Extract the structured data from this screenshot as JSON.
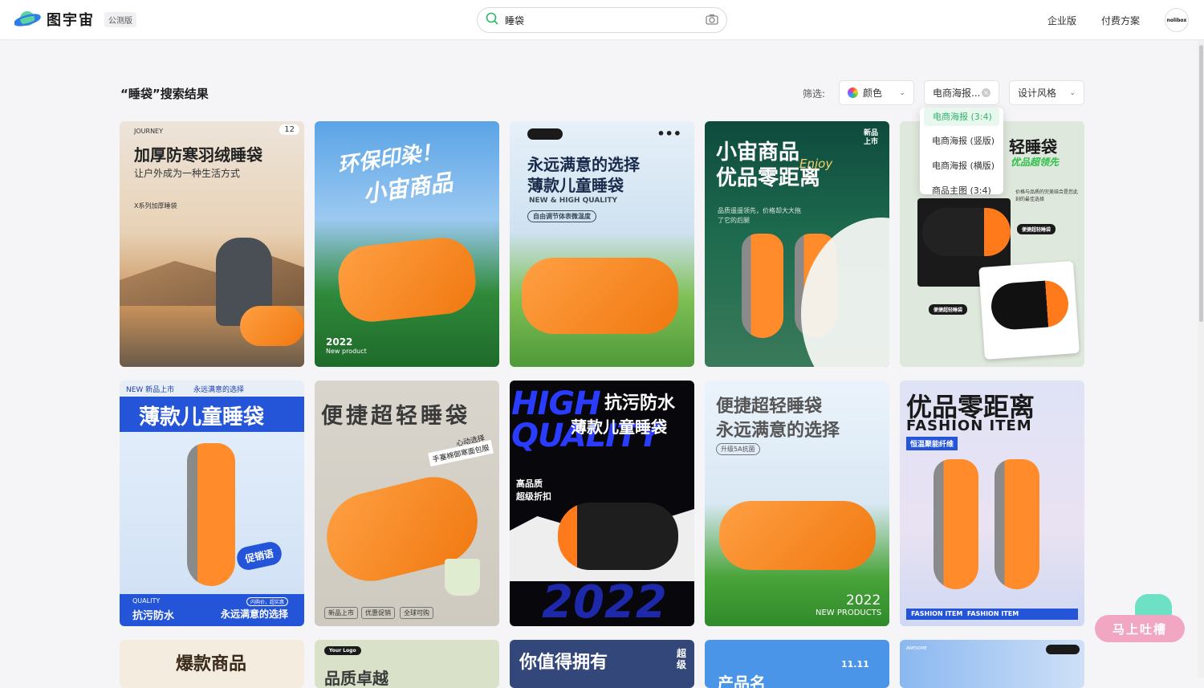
{
  "header": {
    "logo_text": "图宇宙",
    "beta_label": "公测版",
    "search_value": "睡袋",
    "enterprise_link": "企业版",
    "pricing_link": "付费方案",
    "avatar_text": "nolibox"
  },
  "results": {
    "title": "“睡袋”搜索结果",
    "filter_label": "筛选:",
    "filters": {
      "color": "颜色",
      "type": "电商海报...",
      "style": "设计风格"
    },
    "dropdown_options": [
      "电商海报 (3:4)",
      "电商海报 (竖版)",
      "电商海报 (横版)",
      "商品主图 (3:4)"
    ]
  },
  "cards": {
    "c1": {
      "tag": "JOURNEY",
      "count": "12",
      "title": "加厚防寒羽绒睡袋",
      "subtitle": "让户外成为一种生活方式",
      "note": "X系列加厚睡袋"
    },
    "c2": {
      "title1": "环保印染！",
      "title2": "小宙商品",
      "year": "2022",
      "sub": "New product"
    },
    "c3": {
      "title1": "永远满意的选择",
      "title2": "薄款儿童睡袋",
      "sub": "NEW & HIGH QUALITY",
      "pill": "自由调节体表微温度"
    },
    "c4": {
      "title1": "小宙商品",
      "title2": "优品零距离",
      "enjoy": "Enjoy",
      "badge": "新品上市",
      "desc": "品质遥遥领先，价格却大大拖了它的后腿"
    },
    "c5": {
      "title": "轻睡袋",
      "sub": "优品超领先",
      "desc": "价格与品质的完美结合是您此刻的最佳选择",
      "label1": "便捷超轻睡袋",
      "label2": "便捷超轻睡袋"
    },
    "c6": {
      "top": "NEW 新品上市",
      "top2": "永远满意的选择",
      "title": "薄款儿童睡袋",
      "promo": "促销语",
      "quality": "QUALITY",
      "foot1": "抗污防水",
      "foot2": "永远满意的选择",
      "tag": "内购价，超实惠"
    },
    "c7": {
      "title": "便捷超轻睡袋",
      "note1": "心动选择",
      "note2": "手塞棉御寒面包服",
      "t1": "新品上市",
      "t2": "优惠促销",
      "t3": "全球可购"
    },
    "c8": {
      "big1": "HIGH",
      "big2": "QUALITY",
      "title1": "抗污防水",
      "title2": "薄款儿童睡袋",
      "sub1": "高品质",
      "sub2": "超级折扣",
      "year": "2022"
    },
    "c9": {
      "title1": "便捷超轻睡袋",
      "title2": "永远满意的选择",
      "pill": "升级5A抗菌",
      "year": "2022",
      "sub": "NEW PRODUCTS"
    },
    "c10": {
      "title": "优品零距离",
      "sub": "FASHION ITEM",
      "tag": "恒温聚能纤维",
      "foot": "FASHION ITEM  FASHION ITEM"
    },
    "c11": {
      "title": "爆款商品"
    },
    "c12": {
      "logo": "Your Logo",
      "title": "品质卓越"
    },
    "c13": {
      "title": "你值得拥有",
      "side": "超级"
    },
    "c14": {
      "date": "11.11",
      "title": "产品名"
    },
    "c15": {
      "sub": "AWESOME"
    }
  },
  "feedback_label": "马上吐槽"
}
